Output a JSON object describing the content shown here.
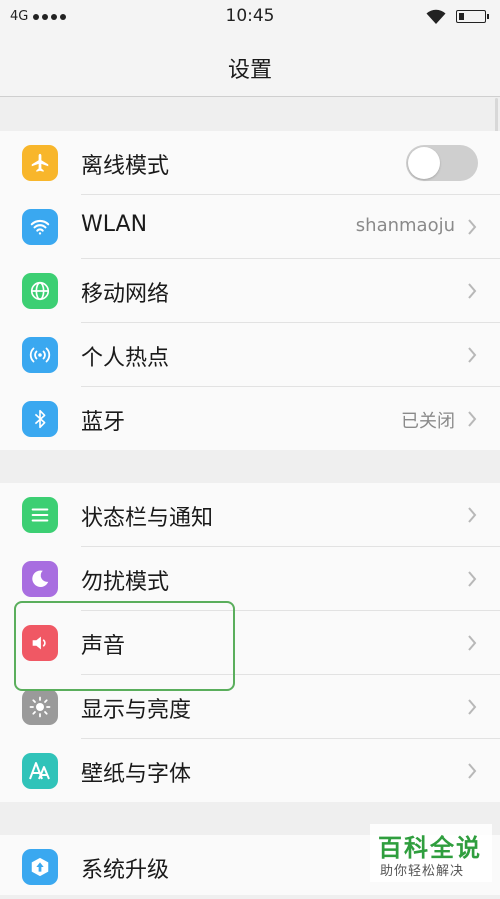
{
  "status_bar": {
    "carrier": "4G",
    "time": "10:45"
  },
  "nav": {
    "title": "设置"
  },
  "groups": [
    {
      "rows": [
        {
          "label": "离线模式",
          "icon": "airplane-icon",
          "color": "#f8b62b",
          "toggle": false
        },
        {
          "label": "WLAN",
          "value": "shanmaoju",
          "icon": "wifi-icon",
          "color": "#3aa8f0"
        },
        {
          "label": "移动网络",
          "icon": "globe-icon",
          "color": "#3ccf73"
        },
        {
          "label": "个人热点",
          "icon": "hotspot-icon",
          "color": "#3aa8f0"
        },
        {
          "label": "蓝牙",
          "value": "已关闭",
          "icon": "bluetooth-icon",
          "color": "#3aa8f0"
        }
      ]
    },
    {
      "rows": [
        {
          "label": "状态栏与通知",
          "icon": "notification-icon",
          "color": "#3ccf73"
        },
        {
          "label": "勿扰模式",
          "icon": "moon-icon",
          "color": "#a86ee0"
        },
        {
          "label": "声音",
          "icon": "speaker-icon",
          "color": "#f05864"
        },
        {
          "label": "显示与亮度",
          "icon": "brightness-icon",
          "color": "#9a9a9a"
        },
        {
          "label": "壁纸与字体",
          "icon": "font-icon",
          "color": "#30c3b9"
        }
      ]
    },
    {
      "rows": [
        {
          "label": "系统升级",
          "icon": "update-icon",
          "color": "#3aa8f0"
        }
      ]
    }
  ],
  "watermark": {
    "title": "百科全说",
    "subtitle": "助你轻松解决"
  }
}
